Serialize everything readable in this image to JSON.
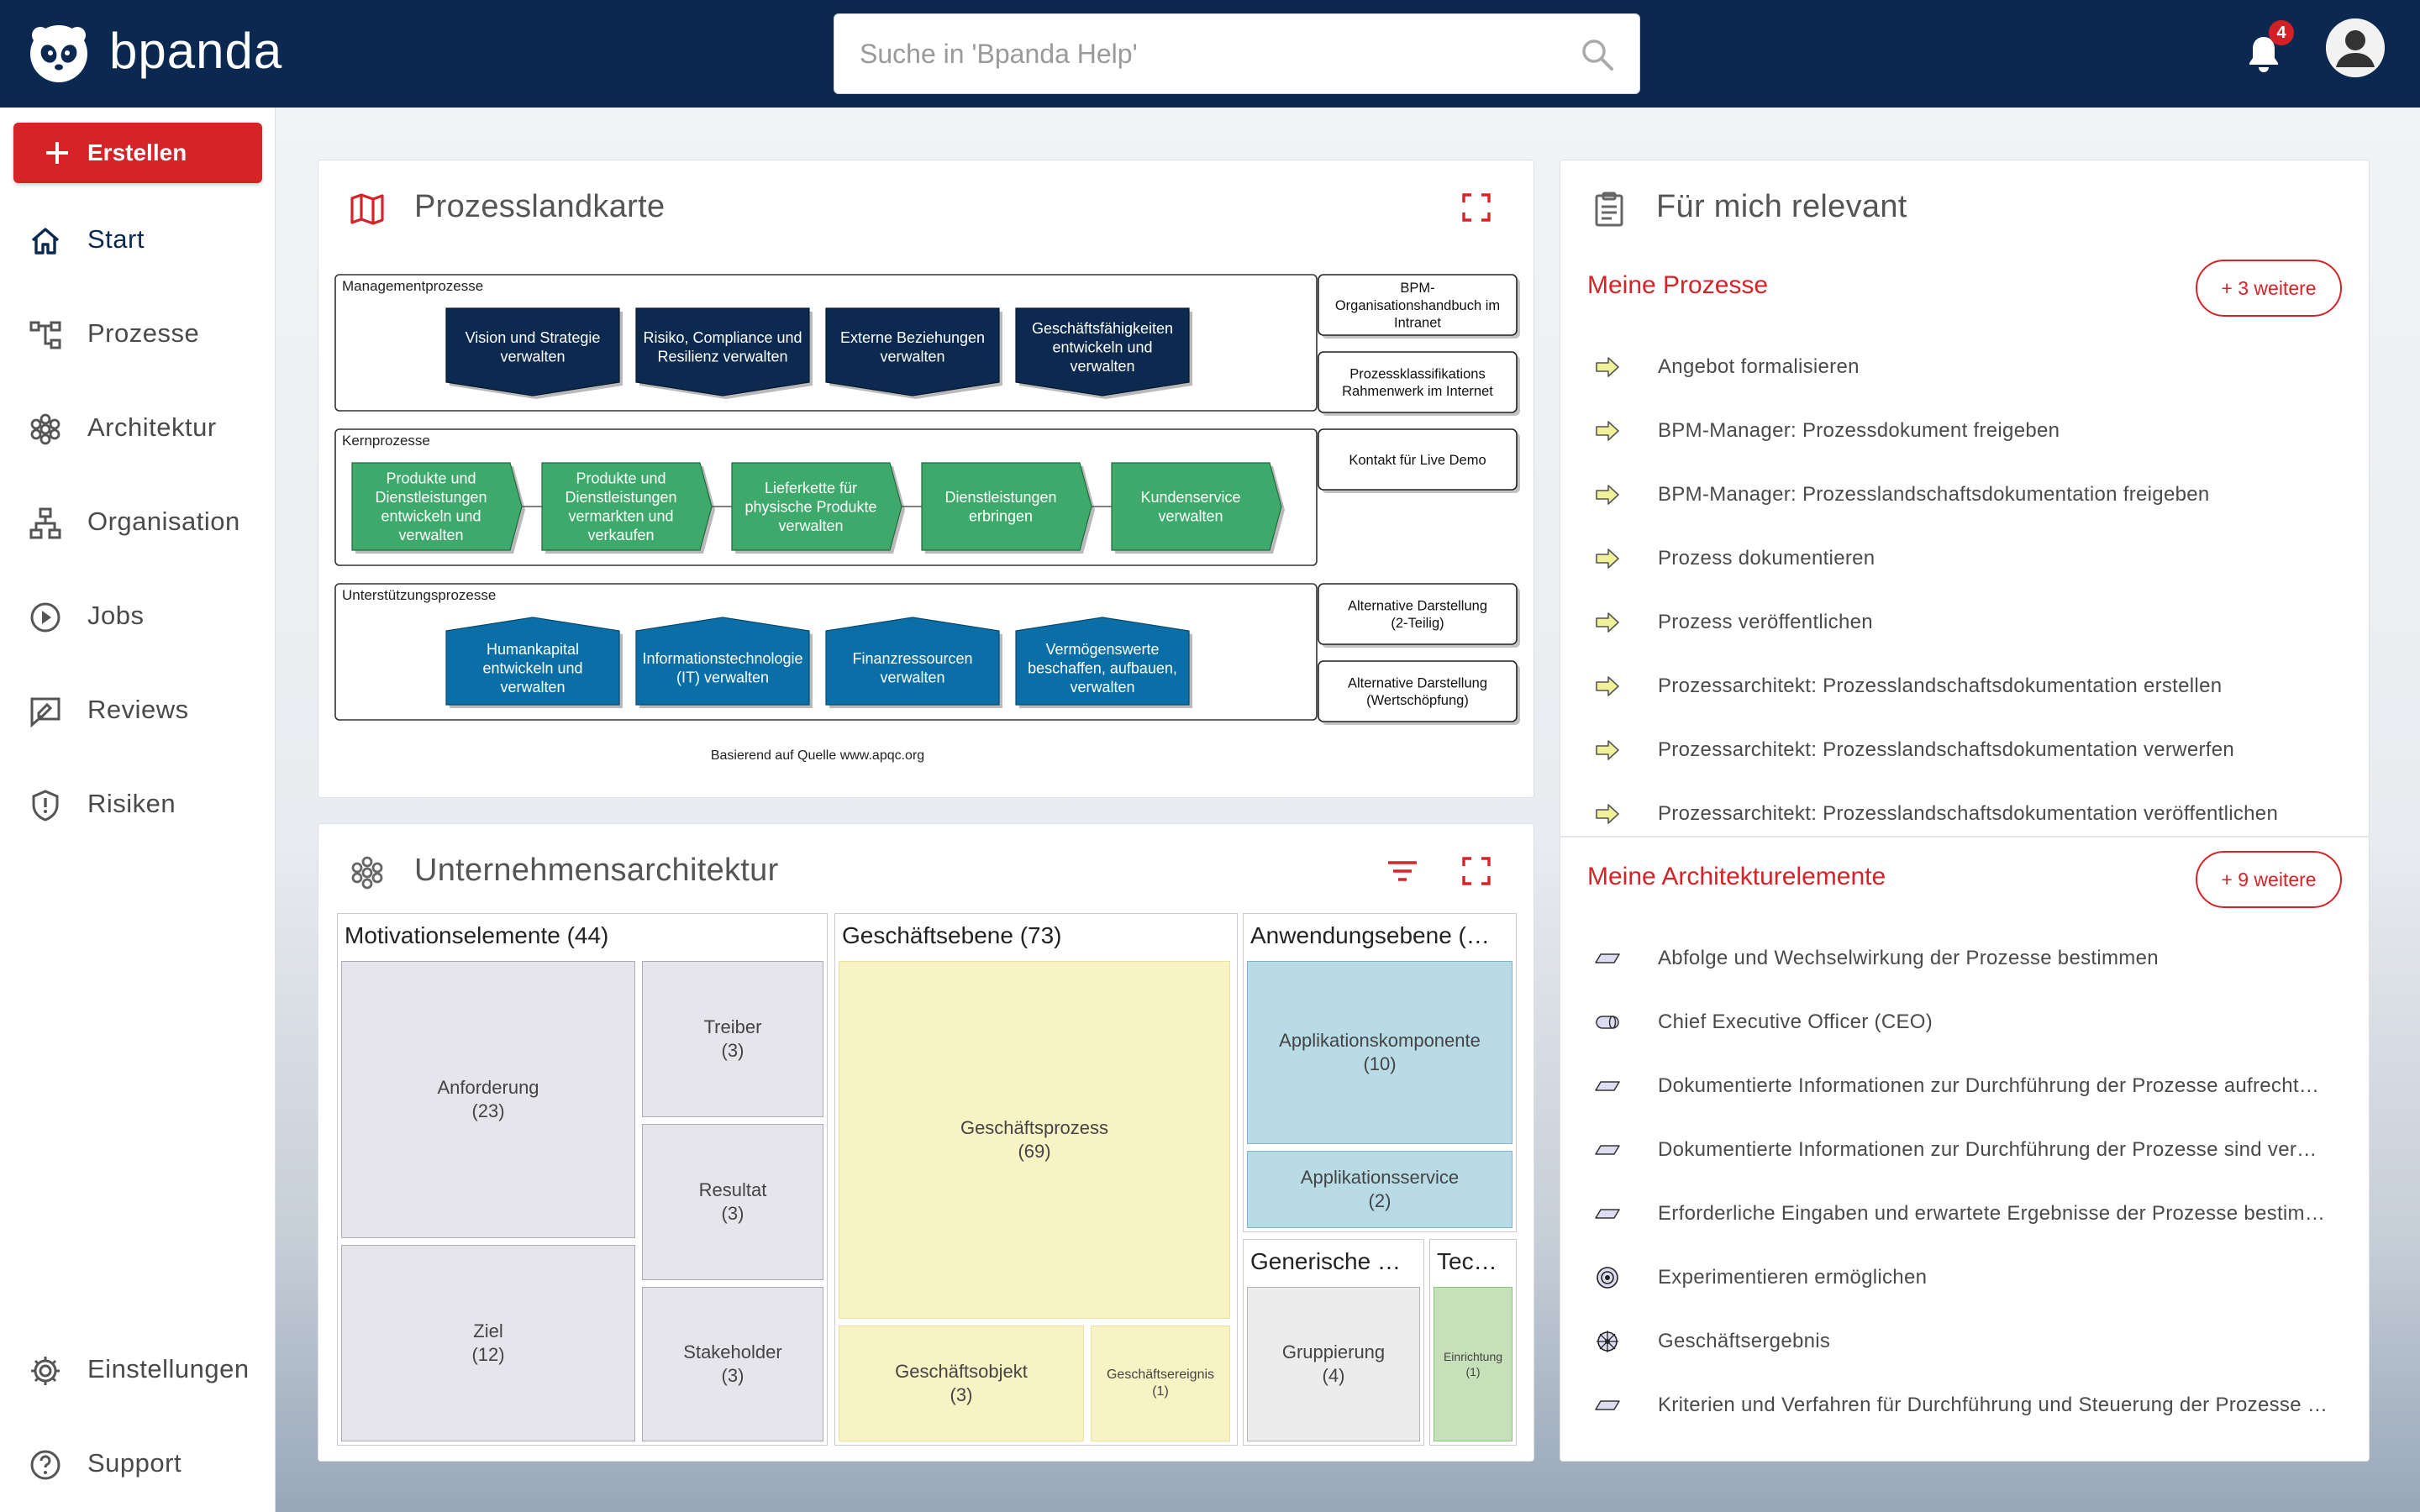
{
  "header": {
    "brand": "bpanda",
    "search_placeholder": "Suche in 'Bpanda Help'",
    "notification_count": "4"
  },
  "sidebar": {
    "create_label": "Erstellen",
    "items": [
      {
        "label": "Start",
        "icon": "home-icon",
        "active": true
      },
      {
        "label": "Prozesse",
        "icon": "process-icon"
      },
      {
        "label": "Architektur",
        "icon": "architecture-icon"
      },
      {
        "label": "Organisation",
        "icon": "org-chart-icon"
      },
      {
        "label": "Jobs",
        "icon": "play-circle-icon"
      },
      {
        "label": "Reviews",
        "icon": "review-icon"
      },
      {
        "label": "Risiken",
        "icon": "shield-icon"
      }
    ],
    "bottom_items": [
      {
        "label": "Einstellungen",
        "icon": "gear-icon"
      },
      {
        "label": "Support",
        "icon": "help-icon"
      }
    ]
  },
  "landscape": {
    "title": "Prozesslandkarte",
    "source_note": "Basierend auf Quelle www.apqc.org",
    "groups": [
      {
        "label": "Managementprozesse",
        "items": [
          {
            "lines": [
              "Vision und Strategie",
              "verwalten"
            ]
          },
          {
            "lines": [
              "Risiko, Compliance und",
              "Resilienz verwalten"
            ]
          },
          {
            "lines": [
              "Externe Beziehungen",
              "verwalten"
            ]
          },
          {
            "lines": [
              "Geschäftsfähigkeiten",
              "entwickeln und",
              "verwalten"
            ]
          }
        ]
      },
      {
        "label": "Kernprozesse",
        "items": [
          {
            "lines": [
              "Produkte und",
              "Dienstleistungen",
              "entwickeln und",
              "verwalten"
            ]
          },
          {
            "lines": [
              "Produkte und",
              "Dienstleistungen",
              "vermarkten und",
              "verkaufen"
            ]
          },
          {
            "lines": [
              "Lieferkette für",
              "physische Produkte",
              "verwalten"
            ]
          },
          {
            "lines": [
              "Dienstleistungen",
              "erbringen"
            ]
          },
          {
            "lines": [
              "Kundenservice",
              "verwalten"
            ]
          }
        ]
      },
      {
        "label": "Unterstützungsprozesse",
        "items": [
          {
            "lines": [
              "Humankapital",
              "entwickeln und",
              "verwalten"
            ]
          },
          {
            "lines": [
              "Informationstechnologie",
              "(IT) verwalten"
            ]
          },
          {
            "lines": [
              "Finanzressourcen",
              "verwalten"
            ]
          },
          {
            "lines": [
              "Vermögenswerte",
              "beschaffen, aufbauen,",
              "verwalten"
            ]
          }
        ]
      }
    ],
    "side_boxes": [
      {
        "lines": [
          "BPM-",
          "Organisationshandbuch im",
          "Intranet"
        ]
      },
      {
        "lines": [
          "Prozessklassifikations",
          "Rahmenwerk im Internet"
        ]
      },
      {
        "lines": [
          "Kontakt für Live Demo"
        ]
      },
      {
        "lines": [
          "Alternative Darstellung",
          "(2-Teilig)"
        ]
      },
      {
        "lines": [
          "Alternative Darstellung",
          "(Wertschöpfung)"
        ]
      }
    ]
  },
  "architecture": {
    "title": "Unternehmensarchitektur",
    "groups": {
      "motivation": {
        "title": "Motivationselemente (44)",
        "cells": [
          {
            "name": "Anforderung",
            "count": "(23)"
          },
          {
            "name": "Treiber",
            "count": "(3)"
          },
          {
            "name": "Resultat",
            "count": "(3)"
          },
          {
            "name": "Ziel",
            "count": "(12)"
          },
          {
            "name": "Stakeholder",
            "count": "(3)"
          }
        ]
      },
      "business": {
        "title": "Geschäftsebene (73)",
        "cells": [
          {
            "name": "Geschäftsprozess",
            "count": "(69)"
          },
          {
            "name": "Geschäftsobjekt",
            "count": "(3)"
          },
          {
            "name": "Geschäftsereignis",
            "count": "(1)"
          }
        ]
      },
      "application": {
        "title": "Anwendungsebene (…",
        "cells": [
          {
            "name": "Applikationskomponente",
            "count": "(10)"
          },
          {
            "name": "Applikationsservice",
            "count": "(2)"
          }
        ]
      },
      "generic": {
        "title": "Generische …",
        "cells": [
          {
            "name": "Gruppierung",
            "count": "(4)"
          }
        ]
      },
      "technology": {
        "title": "Tec…",
        "cells": [
          {
            "name": "Einrichtung",
            "count": "(1)"
          }
        ]
      }
    }
  },
  "relevant": {
    "title": "Für mich relevant",
    "processes": {
      "title": "Meine Prozesse",
      "more": "+ 3 weitere",
      "items": [
        "Angebot formalisieren",
        "BPM-Manager: Prozessdokument freigeben",
        "BPM-Manager: Prozesslandschaftsdokumentation freigeben",
        "Prozess dokumentieren",
        "Prozess veröffentlichen",
        "Prozessarchitekt: Prozesslandschaftsdokumentation erstellen",
        "Prozessarchitekt: Prozesslandschaftsdokumentation verwerfen",
        "Prozessarchitekt: Prozesslandschaftsdokumentation veröffentlichen"
      ]
    },
    "architecture": {
      "title": "Meine Architekturelemente",
      "more": "+ 9 weitere",
      "items": [
        {
          "label": "Abfolge und Wechselwirkung der Prozesse bestimmen",
          "icon": "parallelogram-icon"
        },
        {
          "label": "Chief Executive Officer (CEO)",
          "icon": "actor-role-icon"
        },
        {
          "label": "Dokumentierte Informationen zur Durchführung der Prozesse aufrecht…",
          "icon": "parallelogram-icon"
        },
        {
          "label": "Dokumentierte Informationen zur Durchführung der Prozesse sind ver…",
          "icon": "parallelogram-icon"
        },
        {
          "label": "Erforderliche Eingaben und erwartete Ergebnisse der Prozesse bestim…",
          "icon": "parallelogram-icon"
        },
        {
          "label": "Experimentieren ermöglichen",
          "icon": "target-icon"
        },
        {
          "label": "Geschäftsergebnis",
          "icon": "driver-icon"
        },
        {
          "label": "Kriterien und Verfahren für Durchführung und Steuerung der Prozesse …",
          "icon": "parallelogram-icon"
        }
      ]
    }
  },
  "colors": {
    "header": "#0b2850",
    "accent_red": "#d52328",
    "mgmt": "#0c2a50",
    "core": "#3daa6b",
    "support": "#0a6fa6"
  }
}
